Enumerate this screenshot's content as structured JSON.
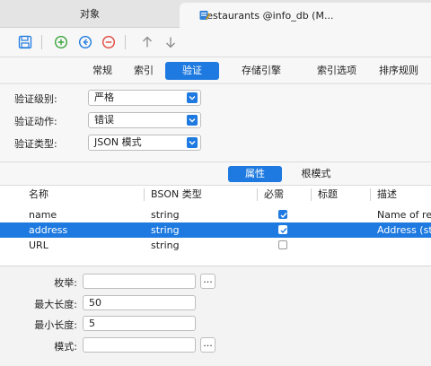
{
  "tabs": {
    "objects_label": "对象",
    "active_label": "restaurants @info_db (M..."
  },
  "toolbar": {
    "save_icon": "save-icon",
    "add_icon": "add-icon",
    "back_icon": "back-icon",
    "remove_icon": "remove-icon",
    "up_icon": "arrow-up-icon",
    "down_icon": "arrow-down-icon"
  },
  "subtabs": [
    "常规",
    "索引",
    "验证",
    "存储引擎",
    "索引选项",
    "排序规则"
  ],
  "active_subtab": "验证",
  "validation": {
    "level_label": "验证级别:",
    "level_value": "严格",
    "action_label": "验证动作:",
    "action_value": "错误",
    "type_label": "验证类型:",
    "type_value": "JSON 模式"
  },
  "view_toggle": {
    "properties": "属性",
    "root_schema": "根模式"
  },
  "table": {
    "headers": [
      "名称",
      "BSON 类型",
      "必需",
      "标题",
      "描述"
    ],
    "rows": [
      {
        "name": "name",
        "type": "string",
        "required": true,
        "title": "",
        "desc": "Name of resta"
      },
      {
        "name": "address",
        "type": "string",
        "required": true,
        "title": "",
        "desc": "Address (strin"
      },
      {
        "name": "URL",
        "type": "string",
        "required": false,
        "title": "",
        "desc": ""
      }
    ],
    "selected_row": 1
  },
  "details": {
    "enum_label": "枚举:",
    "enum_value": "",
    "max_length_label": "最大长度:",
    "max_length_value": "50",
    "min_length_label": "最小长度:",
    "min_length_value": "5",
    "pattern_label": "模式:",
    "pattern_value": "",
    "ellipsis": "..."
  },
  "colors": {
    "accent": "#1e7ae0",
    "add": "#3aa53a",
    "back": "#1e7ae0",
    "remove": "#e0453a"
  }
}
